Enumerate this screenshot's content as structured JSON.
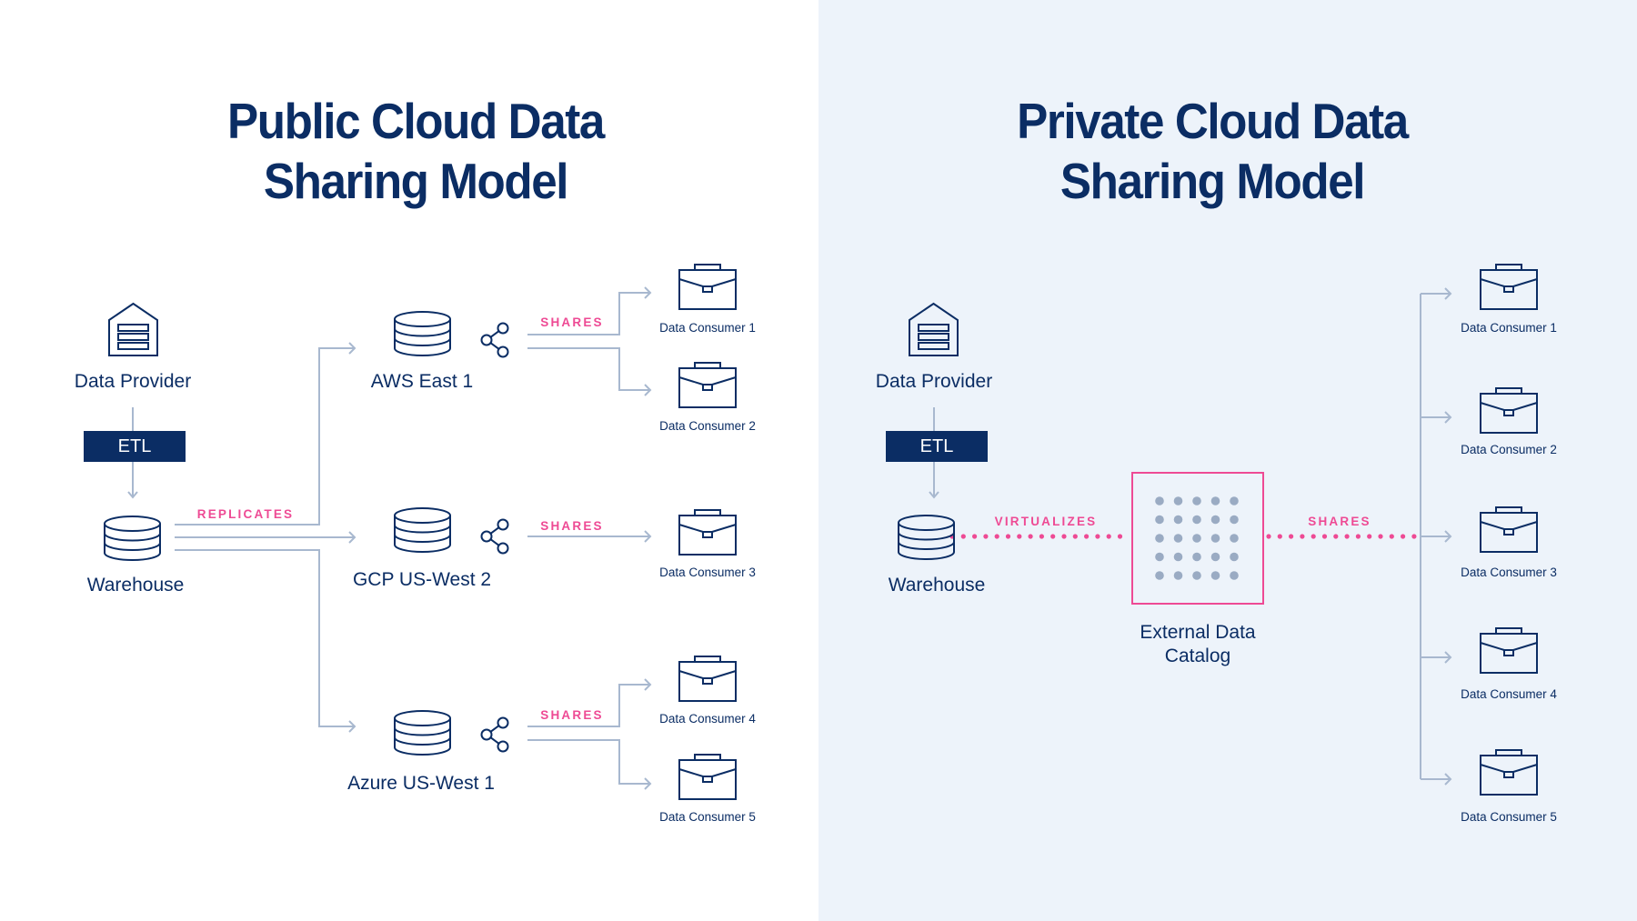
{
  "colors": {
    "navy": "#0b2d64",
    "pink": "#ee4a94",
    "connector": "#a8b8cf",
    "catalog_dot": "#9aabc3",
    "right_bg": "#edf3fa",
    "left_bg": "#ffffff"
  },
  "public": {
    "title_line1": "Public Cloud Data",
    "title_line2": "Sharing Model",
    "provider": {
      "label": "Data Provider",
      "icon": "warehouse-building-icon"
    },
    "etl": "ETL",
    "warehouse": {
      "label": "Warehouse",
      "icon": "database-icon"
    },
    "replicates": "REPLICATES",
    "regions": [
      {
        "label": "AWS East 1",
        "icon": "database-icon",
        "action": "SHARES",
        "consumers": [
          "Data Consumer 1",
          "Data Consumer 2"
        ]
      },
      {
        "label": "GCP US-West 2",
        "icon": "database-icon",
        "action": "SHARES",
        "consumers": [
          "Data Consumer 3"
        ]
      },
      {
        "label": "Azure US-West 1",
        "icon": "database-icon",
        "action": "SHARES",
        "consumers": [
          "Data Consumer 4",
          "Data Consumer 5"
        ]
      }
    ],
    "share_icon": "share-nodes-icon",
    "consumer_icon": "briefcase-icon"
  },
  "private": {
    "title_line1": "Private Cloud Data",
    "title_line2": "Sharing Model",
    "provider": {
      "label": "Data Provider",
      "icon": "warehouse-building-icon"
    },
    "etl": "ETL",
    "warehouse": {
      "label": "Warehouse",
      "icon": "database-icon"
    },
    "virtualizes": "VIRTUALIZES",
    "catalog": {
      "line1": "External Data",
      "line2": "Catalog",
      "icon": "dot-grid-icon",
      "grid": [
        5,
        5
      ]
    },
    "shares": "SHARES",
    "consumers": [
      "Data Consumer 1",
      "Data Consumer 2",
      "Data Consumer 3",
      "Data Consumer 4",
      "Data Consumer 5"
    ],
    "consumer_icon": "briefcase-icon"
  }
}
